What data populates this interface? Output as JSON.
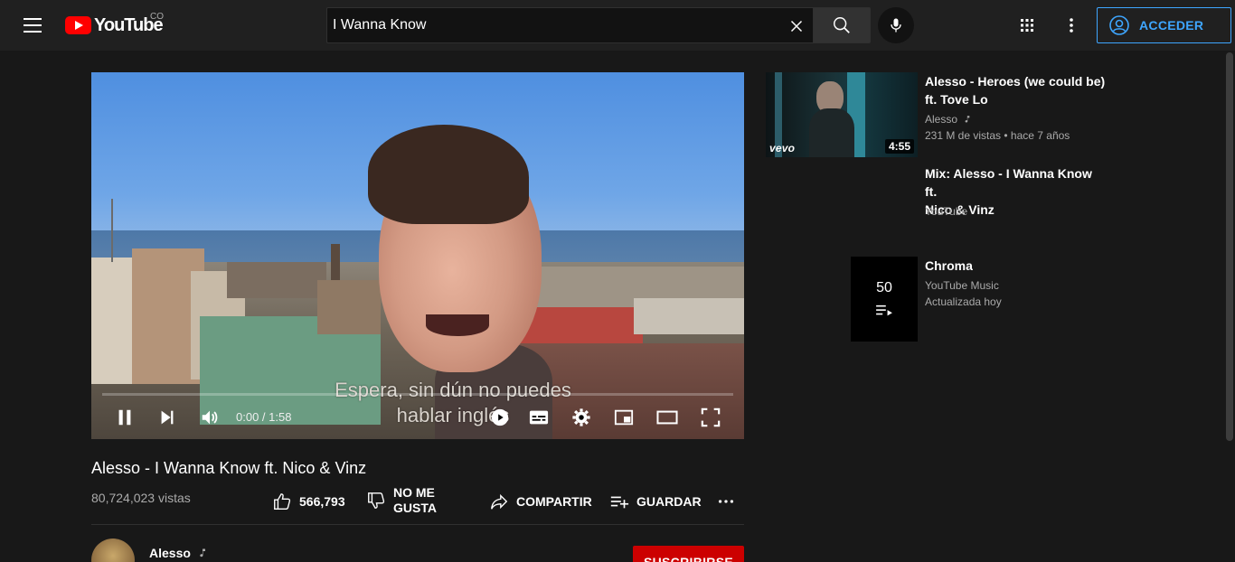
{
  "header": {
    "logo_text": "YouTube",
    "country_code": "CO",
    "search_value": "I Wanna Know",
    "signin_label": "ACCEDER"
  },
  "player": {
    "subtitle_line1": "Espera, sin dún no puedes",
    "subtitle_line2": "hablar inglés",
    "time": "0:00 / 1:58",
    "progress": 0
  },
  "video": {
    "title": "Alesso - I Wanna Know ft. Nico & Vinz",
    "views": "80,724,023 vistas",
    "like_count": "566,793",
    "dislike_label_1": "NO ME",
    "dislike_label_2": "GUSTA",
    "share_label": "COMPARTIR",
    "save_label": "GUARDAR"
  },
  "channel": {
    "name": "Alesso",
    "subscribe_label": "SUSCRIBIRSE"
  },
  "sidebar": {
    "items": [
      {
        "title_line1": "Alesso - Heroes (we could be)",
        "title_line2": "ft. Tove Lo",
        "channel": "Alesso",
        "stats": "231 M de vistas • hace 7 años",
        "duration": "4:55",
        "badge": "vevo"
      },
      {
        "title_line1": "Mix: Alesso - I Wanna Know ft.",
        "title_line2": "Nico & Vinz",
        "channel": "YouTube"
      },
      {
        "title_line1": "Chroma",
        "channel": "YouTube Music",
        "updated": "Actualizada hoy",
        "count": "50"
      }
    ]
  },
  "colors": {
    "background": "#181818",
    "header": "#202020",
    "accent_blue": "#3ea6ff",
    "brand_red": "#ff0000",
    "subscribe_red": "#cc0000"
  }
}
